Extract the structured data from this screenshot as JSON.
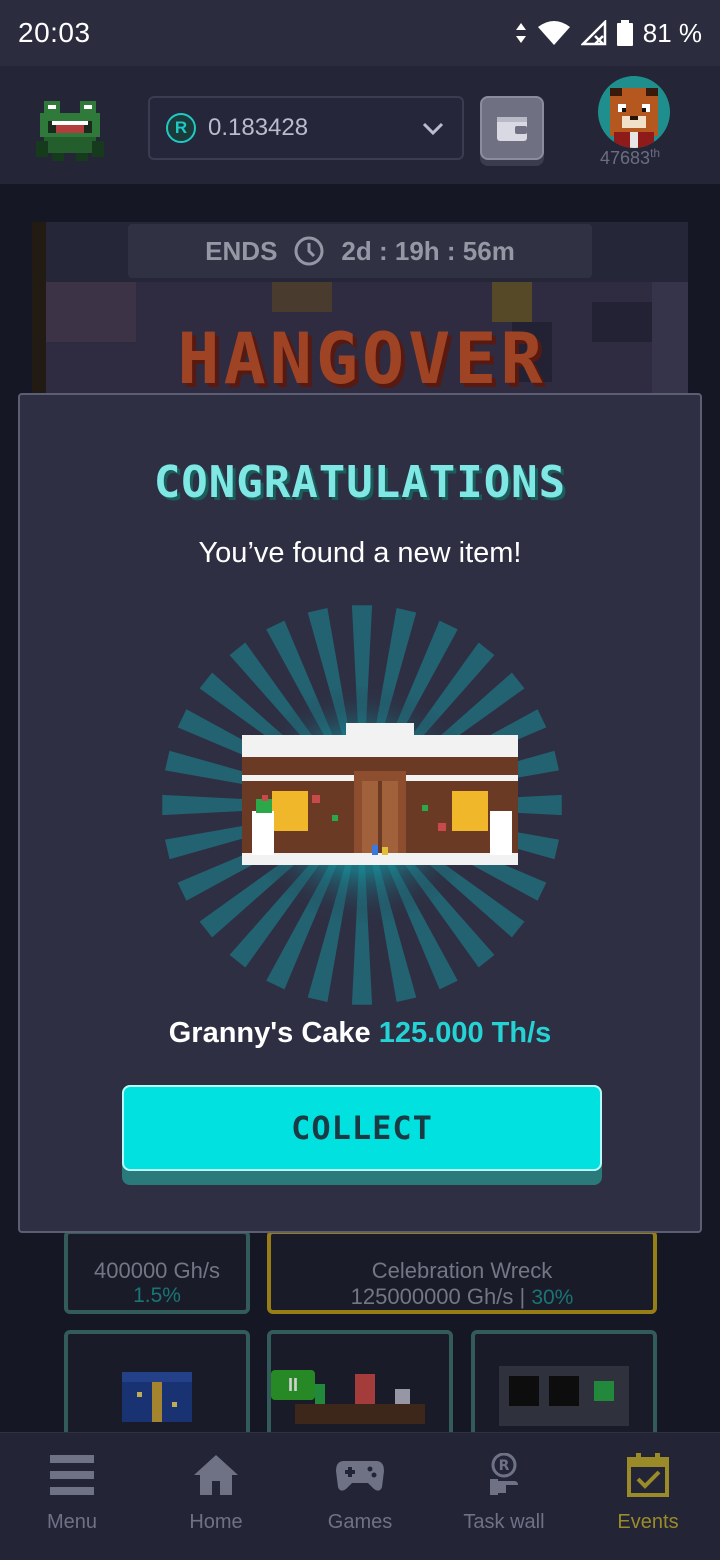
{
  "status_bar": {
    "time": "20:03",
    "battery": "81 %"
  },
  "header": {
    "balance": "0.183428",
    "coin_symbol": "R",
    "rank_number": "47683",
    "rank_suffix": "th"
  },
  "event": {
    "ends_label": "ENDS",
    "countdown": "2d : 19h : 56m",
    "title": "HANGOVER"
  },
  "modal": {
    "title": "CONGRATULATIONS",
    "subtitle": "You’ve found a new item!",
    "item_name": "Granny's Cake",
    "item_power": "125.000 Th/s",
    "collect_label": "COLLECT"
  },
  "background_cards": {
    "card1_power": "400000 Gh/s",
    "card1_bonus": "1.5%",
    "card2_name": "Celebration Wreck",
    "card2_power": "125000000 Gh/s",
    "card2_sep": " | ",
    "card2_bonus": "30%",
    "card4_badge": "II"
  },
  "bottom_nav": {
    "items": [
      {
        "label": "Menu",
        "icon": "menu-icon"
      },
      {
        "label": "Home",
        "icon": "home-icon"
      },
      {
        "label": "Games",
        "icon": "gamepad-icon"
      },
      {
        "label": "Task wall",
        "icon": "task-wall-icon"
      },
      {
        "label": "Events",
        "icon": "calendar-check-icon"
      }
    ],
    "active_index": 4
  },
  "colors": {
    "accent": "#00e1e0",
    "title_cyan": "#7fe7e4",
    "events_gold": "#9a8b28"
  }
}
